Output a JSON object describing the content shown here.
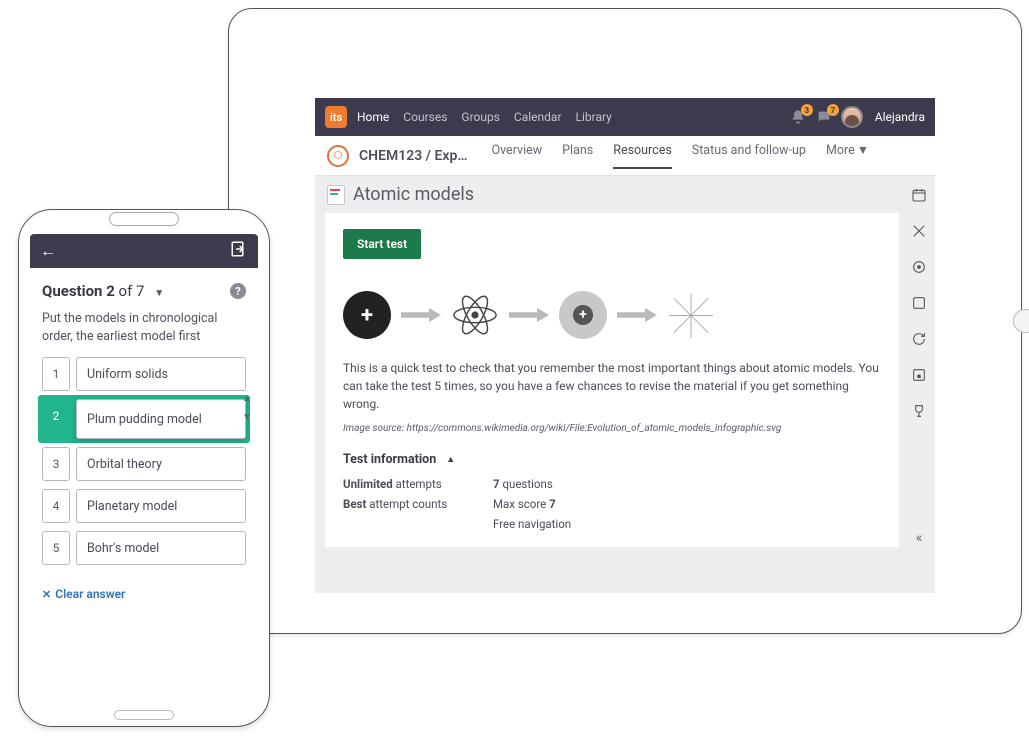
{
  "tablet": {
    "logo": "its",
    "nav": {
      "home": "Home",
      "courses": "Courses",
      "groups": "Groups",
      "calendar": "Calendar",
      "library": "Library"
    },
    "notifications_badge": "3",
    "messages_badge": "7",
    "username": "Alejandra",
    "breadcrumb": "CHEM123 / Exp…",
    "tabs": {
      "overview": "Overview",
      "plans": "Plans",
      "resources": "Resources",
      "status": "Status and follow-up",
      "more": "More"
    },
    "page_title": "Atomic models",
    "start_button": "Start test",
    "description": "This is a quick test to check that you remember the most important things about atomic models. You can take the test 5 times, so you have a few chances to revise the material if you get something wrong.",
    "image_source": "Image source: https://commons.wikimedia.org/wiki/File:Evolution_of_atomic_models_infographic.svg",
    "test_info_title": "Test information",
    "test_info": {
      "attempts_label": "Unlimited",
      "attempts_suffix": " attempts",
      "score_label": "Best",
      "score_suffix": " attempt counts",
      "questions_label": "7",
      "questions_suffix": " questions",
      "maxscore_prefix": "Max score ",
      "maxscore_value": "7",
      "nav": "Free navigation"
    }
  },
  "phone": {
    "question_label": "Question 2",
    "question_total": " of 7",
    "prompt": "Put the models in chronological order, the earliest model first",
    "options": {
      "n1": "1",
      "l1": "Uniform solids",
      "n2": "2",
      "l2": "Plum pudding model",
      "n3": "3",
      "l3": "Orbital theory",
      "n4": "4",
      "l4": "Planetary model",
      "n5": "5",
      "l5": "Bohr's model"
    },
    "clear": "Clear answer"
  }
}
